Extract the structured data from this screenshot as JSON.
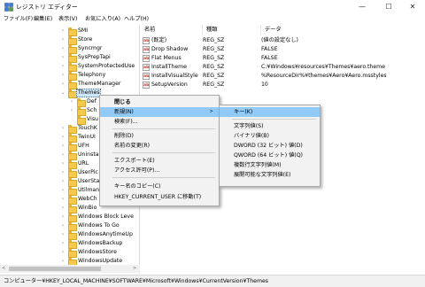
{
  "window": {
    "title": "レジストリ エディター",
    "controls": {
      "minimize": "—",
      "maximize": "☐",
      "close": "✕"
    }
  },
  "menubar": [
    "ファイル(F)",
    "編集(E)",
    "表示(V)",
    "お気に入り(A)",
    "ヘルプ(H)"
  ],
  "tree": {
    "items": [
      {
        "label": "SMI",
        "level": 0
      },
      {
        "label": "Store",
        "level": 0
      },
      {
        "label": "Syncmgr",
        "level": 0
      },
      {
        "label": "SysPrepTapi",
        "level": 0
      },
      {
        "label": "SystemProtectedUse",
        "level": 0
      },
      {
        "label": "Telephony",
        "level": 0
      },
      {
        "label": "ThemeManager",
        "level": 0
      },
      {
        "label": "Themes",
        "level": 0,
        "selected": true,
        "expanded": true
      },
      {
        "label": "Def",
        "level": 1
      },
      {
        "label": "Sch",
        "level": 1
      },
      {
        "label": "Visu",
        "level": 1
      },
      {
        "label": "TouchK",
        "level": 0
      },
      {
        "label": "TwinUI",
        "level": 0
      },
      {
        "label": "UFH",
        "level": 0
      },
      {
        "label": "Uninsta",
        "level": 0
      },
      {
        "label": "URL",
        "level": 0
      },
      {
        "label": "UserPic",
        "level": 0
      },
      {
        "label": "UserSta",
        "level": 0
      },
      {
        "label": "Utilman",
        "level": 0
      },
      {
        "label": "WebCh",
        "level": 0
      },
      {
        "label": "WinBio",
        "level": 0
      },
      {
        "label": "Windows Block Leve",
        "level": 0
      },
      {
        "label": "Windows To Go",
        "level": 0
      },
      {
        "label": "WindowsAnytimeUp",
        "level": 0
      },
      {
        "label": "WindowsBackup",
        "level": 0
      },
      {
        "label": "WindowsStore",
        "level": 0
      },
      {
        "label": "WindowsUpdate",
        "level": 0
      }
    ]
  },
  "values": {
    "headers": {
      "name": "名前",
      "type": "種類",
      "data": "データ"
    },
    "rows": [
      {
        "name": "(既定)",
        "type": "REG_SZ",
        "data": "(値の設定なし)"
      },
      {
        "name": "Drop Shadow",
        "type": "REG_SZ",
        "data": "FALSE"
      },
      {
        "name": "Flat Menus",
        "type": "REG_SZ",
        "data": "FALSE"
      },
      {
        "name": "InstallTheme",
        "type": "REG_SZ",
        "data": "C:¥Windows¥resources¥Themes¥aero.theme"
      },
      {
        "name": "InstallVisualStyle",
        "type": "REG_SZ",
        "data": "%ResourceDir%¥themes¥Aero¥Aero.msstyles"
      },
      {
        "name": "SetupVersion",
        "type": "REG_SZ",
        "data": "10"
      }
    ],
    "icon_text": "ab"
  },
  "context_menu": {
    "items": [
      {
        "label": "閉じる",
        "bold": true
      },
      {
        "label": "新規(N)",
        "submenu": true,
        "highlighted": true
      },
      {
        "label": "検索(F)..."
      },
      {
        "sep": true
      },
      {
        "label": "削除(D)"
      },
      {
        "label": "名前の変更(R)"
      },
      {
        "sep": true
      },
      {
        "label": "エクスポート(E)"
      },
      {
        "label": "アクセス許可(P)..."
      },
      {
        "sep": true
      },
      {
        "label": "キー名のコピー(C)"
      },
      {
        "label": "HKEY_CURRENT_USER に移動(T)"
      }
    ],
    "submenu_arrow": ">"
  },
  "submenu": {
    "items": [
      {
        "label": "キー(K)",
        "highlighted": true
      },
      {
        "sep": true
      },
      {
        "label": "文字列値(S)"
      },
      {
        "label": "バイナリ値(B)"
      },
      {
        "label": "DWORD (32 ビット) 値(D)"
      },
      {
        "label": "QWORD (64 ビット) 値(Q)"
      },
      {
        "label": "複数行文字列値(M)"
      },
      {
        "label": "展開可能な文字列値(E)"
      }
    ]
  },
  "statusbar": {
    "path": "コンピューター¥HKEY_LOCAL_MACHINE¥SOFTWARE¥Microsoft¥Windows¥CurrentVersion¥Themes"
  },
  "scrollbar": {
    "left_arrow": "<",
    "right_arrow": ">"
  },
  "colors": {
    "selection": "#cce8ff",
    "menu_highlight": "#91c9f7",
    "folder": "#f5c94e"
  }
}
